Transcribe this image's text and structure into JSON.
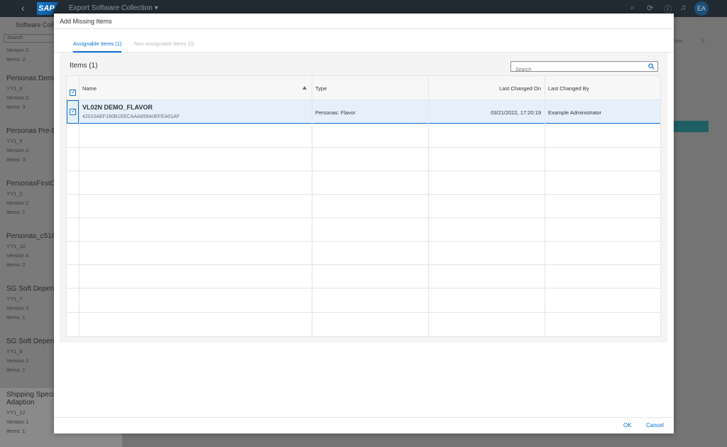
{
  "shell": {
    "back_glyph": "‹",
    "logo_text": "SAP",
    "app_title": "Export Software Collection ▾",
    "avatar_initials": "EA",
    "icons": [
      "search-icon",
      "sync-icon",
      "help-icon",
      "bell-icon"
    ]
  },
  "background": {
    "left_header": "Software Colle",
    "search_placeholder": "Search",
    "top_lines": [
      "Version 2",
      "Items: 2"
    ],
    "items": [
      {
        "title": "Personas Demo",
        "lines": [
          "YY1_6",
          "Version 2",
          "Items: 3"
        ]
      },
      {
        "title": "Personas Pre-D",
        "lines": [
          "YY1_5",
          "Version 2",
          "Items: 3"
        ]
      },
      {
        "title": "PersonasFirstCo",
        "lines": [
          "YY1_2",
          "Version 2",
          "Items: 1"
        ]
      },
      {
        "title": "Personas_c516",
        "lines": [
          "YY1_10",
          "Version 4",
          "Items: 2"
        ]
      },
      {
        "title": "SG Soft Depend",
        "lines": [
          "YY1_7",
          "Version 3",
          "Items: 1"
        ]
      },
      {
        "title": "SG Soft Depend",
        "lines": [
          "YY1_8",
          "Version 1",
          "Items: 1"
        ]
      },
      {
        "title": "Shipping Special",
        "title2": "Adaption",
        "lines": [
          "YY1_12",
          "Version 1",
          "Items: 1"
        ]
      }
    ],
    "right_text": "lete",
    "right_count": "0"
  },
  "dialog": {
    "title": "Add Missing Items",
    "tabs": [
      {
        "label": "Assignable Items (1)",
        "active": true
      },
      {
        "label": "Non-Assignable Items (0)",
        "active": false
      }
    ],
    "table_title": "Items (1)",
    "search_placeholder": "Search",
    "columns": [
      "Name",
      "Type",
      "Last Changed On",
      "Last Changed By"
    ],
    "rows": [
      {
        "name": "VL02N DEMO_FLAVOR",
        "id": "42010AEF160B1EECAAA659A0EFEA01AF",
        "type": "Personas: Flavor",
        "changed_on": "03/21/2022, 17:20:19",
        "changed_by": "Example Administrator",
        "selected": true
      }
    ],
    "ok_label": "OK",
    "cancel_label": "Cancel"
  },
  "colors": {
    "accent": "#0a6ed1",
    "shell": "#222b33",
    "selected_row": "#e5f0fa"
  }
}
